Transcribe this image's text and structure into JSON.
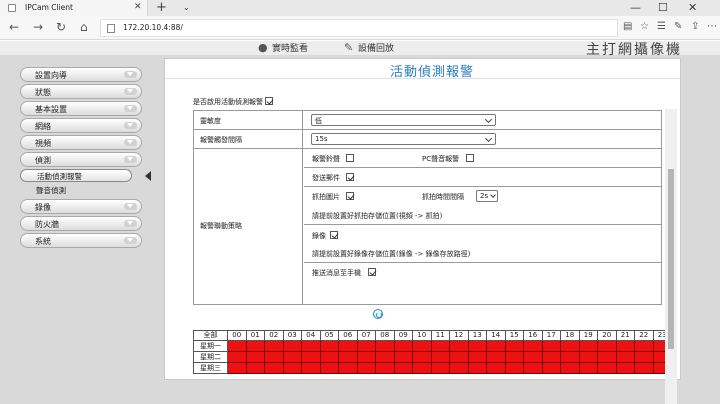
{
  "browser": {
    "tab_title": "IPCam Client",
    "url": "172.20.10.4:88/",
    "close_tab": "✕",
    "new_tab": "+",
    "minimize": "—",
    "maximize": "☐",
    "close_window": "✕"
  },
  "header": {
    "link1": "實時監看",
    "link2": "設備回放",
    "brand": "主打網攝像機"
  },
  "sidebar": {
    "items": [
      {
        "label": "設置向導"
      },
      {
        "label": "狀態"
      },
      {
        "label": "基本設置"
      },
      {
        "label": "網絡"
      },
      {
        "label": "視頻"
      },
      {
        "label": "偵測"
      }
    ],
    "subitems": [
      {
        "label": "活動偵測報警"
      },
      {
        "label": "聲音偵測"
      }
    ],
    "items_after": [
      {
        "label": "錄像"
      },
      {
        "label": "防火牆"
      },
      {
        "label": "系統"
      }
    ]
  },
  "panel": {
    "title": "活動偵測報警",
    "enable_label": "是否啟用活動偵測報警",
    "enable_checked": true,
    "sensitivity_label": "靈敏度",
    "sensitivity_value": "低",
    "interval_label": "報警觸發間隔",
    "interval_value": "15s",
    "linkage_label": "報警聯動策略",
    "alarm_sound_label": "報警鈴聲",
    "alarm_sound_checked": false,
    "pc_sound_label": "PC聲音報警",
    "pc_sound_checked": false,
    "send_email_label": "發送郵件",
    "send_email_checked": true,
    "snapshot_label": "抓拍圖片",
    "snapshot_checked": true,
    "snap_interval_label": "抓拍時間間隔",
    "snap_interval_value": "2s",
    "snapshot_note": "請提前設置好抓拍存儲位置(視頻 -> 抓拍)",
    "record_label": "錄像",
    "record_checked": true,
    "record_note": "請提前設置好錄像存儲位置(錄像 -> 錄像存放路徑)",
    "push_label": "推送消息至手機",
    "push_checked": true
  },
  "schedule": {
    "all_label": "全部",
    "hours": [
      "00",
      "01",
      "02",
      "03",
      "04",
      "05",
      "06",
      "07",
      "08",
      "09",
      "10",
      "11",
      "12",
      "13",
      "14",
      "15",
      "16",
      "17",
      "18",
      "19",
      "20",
      "21",
      "22",
      "23"
    ],
    "days": [
      "星期一",
      "星期二",
      "星期三"
    ],
    "active_color": "#ee1111"
  }
}
